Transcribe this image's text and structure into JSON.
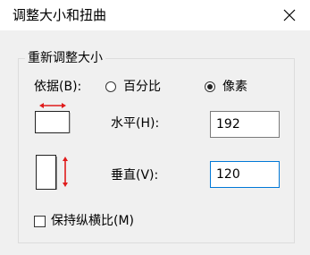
{
  "window": {
    "title": "调整大小和扭曲"
  },
  "group": {
    "legend": "重新调整大小"
  },
  "basis": {
    "label": "依据(B):",
    "options": [
      {
        "label": "百分比",
        "checked": false
      },
      {
        "label": "像素",
        "checked": true
      }
    ]
  },
  "horizontal": {
    "label": "水平(H):",
    "value": "192"
  },
  "vertical": {
    "label": "垂直(V):",
    "value": "120"
  },
  "keep_aspect": {
    "label": "保持纵横比(M)",
    "checked": false
  },
  "colors": {
    "arrow": "#e01b1b",
    "focus_border": "#0078d7"
  },
  "icons": [
    "close-icon",
    "horizontal-resize-icon",
    "vertical-resize-icon"
  ]
}
